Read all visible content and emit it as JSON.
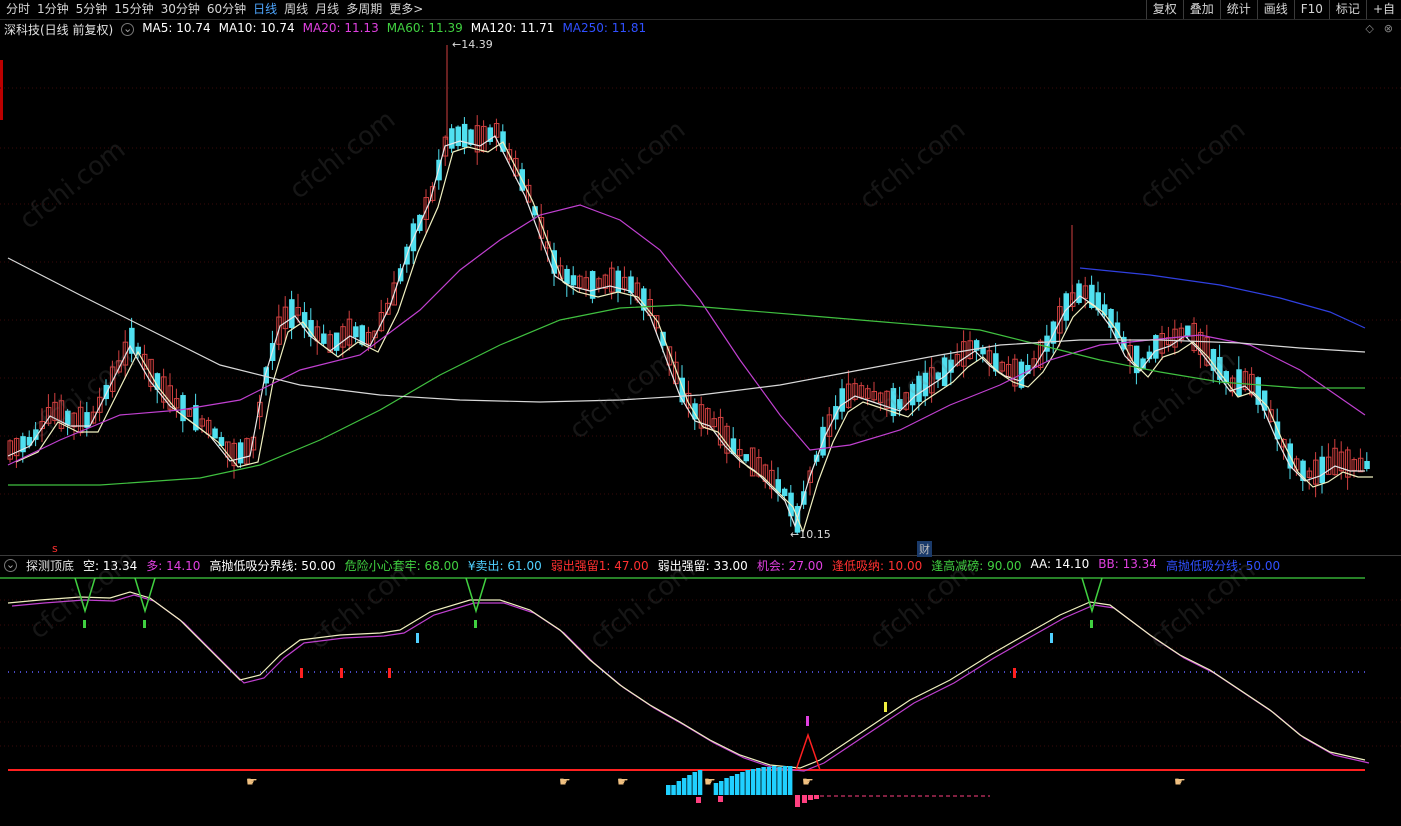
{
  "toolbar": {
    "periods": [
      "分时",
      "1分钟",
      "5分钟",
      "15分钟",
      "30分钟",
      "60分钟",
      "日线",
      "周线",
      "月线",
      "多周期",
      "更多>"
    ],
    "active_period": "日线",
    "tools": [
      "复权",
      "叠加",
      "统计",
      "画线",
      "F10",
      "标记",
      "+自"
    ]
  },
  "main": {
    "title": "深科技(日线 前复权)",
    "mas": [
      {
        "label": "MA5: 10.74",
        "color": "#ffffff"
      },
      {
        "label": "MA10: 10.74",
        "color": "#ffffff"
      },
      {
        "label": "MA20: 11.13",
        "color": "#e040e0"
      },
      {
        "label": "MA60: 11.39",
        "color": "#40d040"
      },
      {
        "label": "MA120: 11.71",
        "color": "#ffffff"
      },
      {
        "label": "MA250: 11.81",
        "color": "#3050ff"
      }
    ],
    "high_label": "14.39",
    "low_label": "10.15",
    "cai_badge": "财",
    "s_badge": "s",
    "watermark": "cfchi.com"
  },
  "indicator": {
    "name": "探测顶底",
    "items": [
      {
        "label": "空: 13.34",
        "color": "#ffffff"
      },
      {
        "label": "多: 14.10",
        "color": "#e040e0"
      },
      {
        "label": "高抛低吸分界线: 50.00",
        "color": "#ffffff"
      },
      {
        "label": "危险小心套牢: 68.00",
        "color": "#40d040"
      },
      {
        "label": "¥卖出: 61.00",
        "color": "#50d0ff"
      },
      {
        "label": "弱出强留1: 47.00",
        "color": "#ff3030"
      },
      {
        "label": "弱出强留: 33.00",
        "color": "#ffffff"
      },
      {
        "label": "机会: 27.00",
        "color": "#e040e0"
      },
      {
        "label": "逢低吸纳: 10.00",
        "color": "#ff3030"
      },
      {
        "label": "逢高减磅: 90.00",
        "color": "#40d040"
      },
      {
        "label": "AA: 14.10",
        "color": "#ffffff"
      },
      {
        "label": "BB: 13.34",
        "color": "#e040e0"
      },
      {
        "label": "高抛低吸分线: 50.00",
        "color": "#3050ff"
      }
    ]
  }
}
